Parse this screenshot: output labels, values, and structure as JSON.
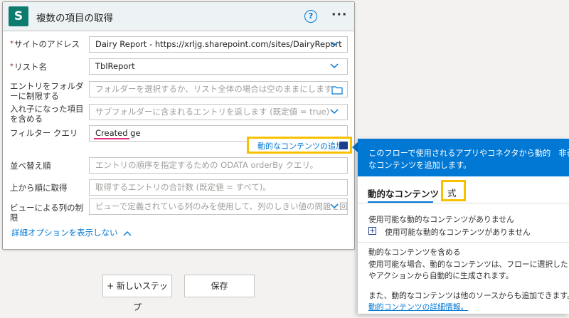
{
  "card": {
    "icon_letter": "S",
    "title": "複数の項目の取得",
    "help_glyph": "?",
    "more_glyph": "···"
  },
  "fields": {
    "site": {
      "label": "サイトのアドレス",
      "value": "Dairy Report - https://xrljg.sharepoint.com/sites/DairyReport"
    },
    "list": {
      "label": "リスト名",
      "value": "TblReport"
    },
    "folder": {
      "label": "エントリをフォルダーに制限する",
      "placeholder": "フォルダーを選択するか、リスト全体の場合は空のままにします"
    },
    "nested": {
      "label": "入れ子になった項目を含める",
      "placeholder": "サブフォルダーに含まれるエントリを返します (既定値 = true)"
    },
    "filter": {
      "label": "フィルター クエリ",
      "value": "Created ge"
    },
    "order": {
      "label": "並べ替え順",
      "placeholder": "エントリの順序を指定するための ODATA orderBy クエリ。"
    },
    "top": {
      "label": "上から順に取得",
      "placeholder": "取得するエントリの合計数 (既定値 = すべて)。"
    },
    "view": {
      "label": "ビューによる列の制限",
      "placeholder": "ビューで定義されている列のみを使用して、列のしきい値の問題を回避"
    }
  },
  "dynamic_content_link": "動的なコンテンツの追加",
  "advanced_toggle": "詳細オプションを表示しない",
  "buttons": {
    "new_step": "+ 新しいステップ",
    "save": "保存"
  },
  "flyout": {
    "description_line1": "このフローで使用されるアプリやコネクタから動的　非表",
    "description_line2": "なコンテンツを追加します。",
    "tab_dynamic": "動的なコンテンツ",
    "tab_expression": "式",
    "no_content_heading": "使用可能な動的なコンテンツがありません",
    "no_content_item": "使用可能な動的なコンテンツがありません",
    "include_heading": "動的なコンテンツを含める",
    "include_text1": "使用可能な場合、動的なコンテンツは、フローに選択したコネ",
    "include_text2": "やアクションから自動的に生成されます。",
    "also_text": "また、動的なコンテンツは他のソースからも追加できます。",
    "details_link": "動的コンテンツの詳細情報。"
  },
  "colors": {
    "accent": "#0078d4",
    "highlight": "#f8c100",
    "token": "#e3317b"
  }
}
